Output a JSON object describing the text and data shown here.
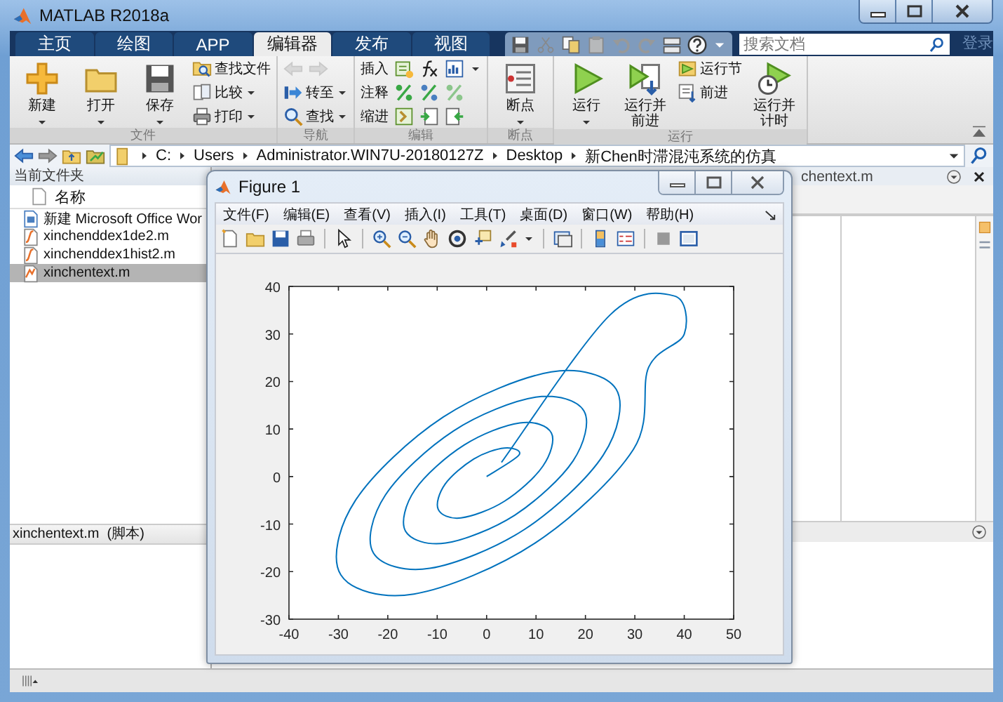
{
  "window": {
    "title": "MATLAB R2018a"
  },
  "tabs": [
    {
      "label": "主页",
      "selected": false
    },
    {
      "label": "绘图",
      "selected": false
    },
    {
      "label": "APP",
      "selected": false
    },
    {
      "label": "编辑器",
      "selected": true
    },
    {
      "label": "发布",
      "selected": false
    },
    {
      "label": "视图",
      "selected": false
    }
  ],
  "search": {
    "placeholder": "搜索文档"
  },
  "sign_in": "登录",
  "ribbon": {
    "groups": [
      {
        "label": "文件",
        "items": [
          {
            "kind": "large",
            "label": "新建",
            "dropdown": true
          },
          {
            "kind": "large",
            "label": "打开",
            "dropdown": true
          },
          {
            "kind": "large",
            "label": "保存",
            "dropdown": true
          },
          {
            "kind": "small",
            "label": "查找文件",
            "dropdown": false
          },
          {
            "kind": "small",
            "label": "比较",
            "dropdown": true
          },
          {
            "kind": "small",
            "label": "打印",
            "dropdown": true
          }
        ]
      },
      {
        "label": "导航",
        "items": [
          {
            "kind": "arrows",
            "disabled": true
          },
          {
            "kind": "small",
            "label": "转至",
            "dropdown": true
          },
          {
            "kind": "small",
            "label": "查找",
            "dropdown": true
          }
        ]
      },
      {
        "label": "编辑",
        "items": [
          {
            "kind": "row",
            "label": "插入",
            "dropdown": true
          },
          {
            "kind": "row",
            "label": "注释",
            "dropdown": false
          },
          {
            "kind": "row",
            "label": "缩进",
            "dropdown": false
          }
        ]
      },
      {
        "label": "断点",
        "items": [
          {
            "kind": "large",
            "label": "断点",
            "dropdown": true
          }
        ]
      },
      {
        "label": "运行",
        "items": [
          {
            "kind": "large",
            "label": "运行",
            "dropdown": true
          },
          {
            "kind": "large",
            "label": "运行并前进",
            "dropdown": false
          },
          {
            "kind": "small",
            "label": "运行节",
            "dropdown": false
          },
          {
            "kind": "small",
            "label": "前进",
            "dropdown": false
          },
          {
            "kind": "large",
            "label": "运行并计时",
            "dropdown": false
          }
        ]
      }
    ]
  },
  "address": {
    "path": [
      "C:",
      "Users",
      "Administrator.WIN7U-20180127Z",
      "Desktop",
      "新Chen时滞混沌系统的仿真"
    ]
  },
  "files": {
    "title": "当前文件夹",
    "column": "名称",
    "items": [
      {
        "name": "新建 Microsoft Office Wor",
        "kind": "doc",
        "selected": false
      },
      {
        "name": "xinchenddex1de2.m",
        "kind": "mfunc",
        "selected": false
      },
      {
        "name": "xinchenddex1hist2.m",
        "kind": "mfunc",
        "selected": false
      },
      {
        "name": "xinchentext.m",
        "kind": "mscript",
        "selected": true
      }
    ],
    "details": "xinchentext.m  (脚本)"
  },
  "editor": {
    "tab": "chentext.m"
  },
  "figure": {
    "title": "Figure 1",
    "menu": [
      "文件(F)",
      "编辑(E)",
      "查看(V)",
      "插入(I)",
      "工具(T)",
      "桌面(D)",
      "窗口(W)",
      "帮助(H)"
    ],
    "chart_data": {
      "type": "line",
      "x": [
        0,
        6.6,
        3.6,
        -2.6,
        -8.4,
        -9.8,
        -5.2,
        3.6,
        11.4,
        13.1,
        6.7,
        -4.6,
        -14.5,
        -16.4,
        -8.3,
        5.7,
        17.5,
        19.7,
        9.9,
        -6.7,
        -20.5,
        -22.9,
        -11.5,
        7.7,
        23.6,
        26.2,
        13.1,
        -8.8,
        -26.6,
        -29.5,
        -14.7,
        9.8,
        29.7,
        32.8,
        40,
        38,
        25,
        3
      ],
      "series": [
        {
          "color": "#0072bd",
          "values": [
            0,
            4.6,
            6.0,
            3.7,
            -1.6,
            -6.9,
            -8.7,
            -5.2,
            2.2,
            9.2,
            11.3,
            6.6,
            -2.8,
            -11.5,
            -14.0,
            -8.1,
            3.3,
            13.8,
            16.7,
            9.6,
            -3.9,
            -16.1,
            -19.3,
            -11.1,
            4.5,
            18.4,
            22.0,
            12.5,
            -5.1,
            -20.7,
            -24.7,
            -14.0,
            5.7,
            23.0,
            30,
            38,
            34,
            3
          ]
        }
      ],
      "xlim": [
        -40,
        50
      ],
      "ylim": [
        -30,
        40
      ],
      "xticks": [
        -40,
        -30,
        -20,
        -10,
        0,
        10,
        20,
        30,
        40,
        50
      ],
      "yticks": [
        -30,
        -20,
        -10,
        0,
        10,
        20,
        30,
        40
      ]
    }
  }
}
